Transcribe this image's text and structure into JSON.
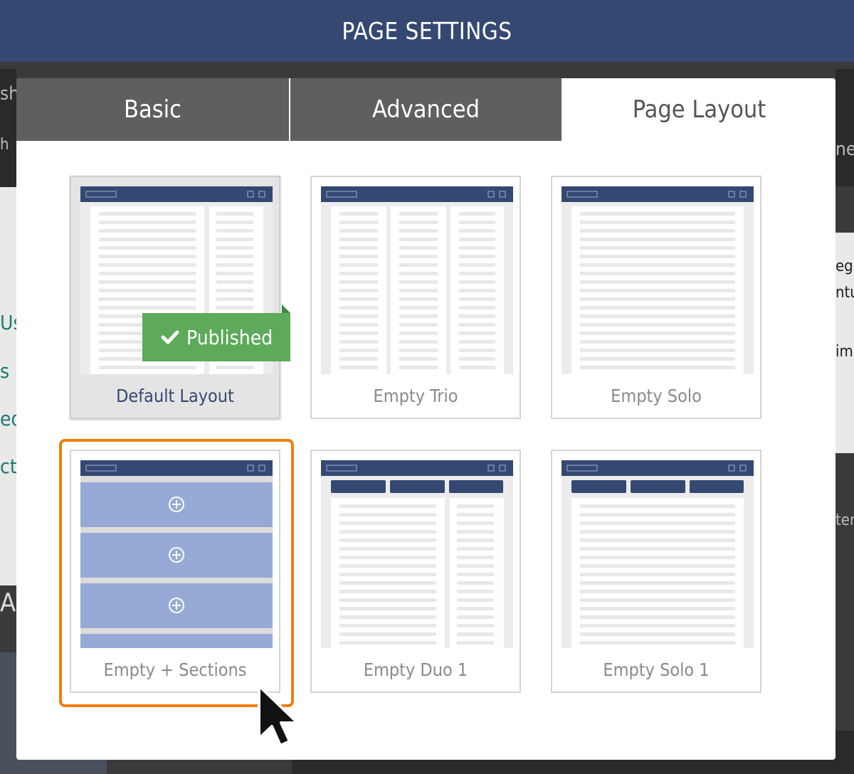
{
  "header": {
    "title": "PAGE SETTINGS"
  },
  "tabs": [
    {
      "label": "Basic",
      "active": false
    },
    {
      "label": "Advanced",
      "active": false
    },
    {
      "label": "Page Layout",
      "active": true
    }
  ],
  "layouts": [
    {
      "label": "Default Layout",
      "published": true
    },
    {
      "label": "Empty Trio"
    },
    {
      "label": "Empty Solo"
    },
    {
      "label": "Empty + Sections",
      "selected": true
    },
    {
      "label": "Empty Duo 1"
    },
    {
      "label": "Empty Solo 1"
    }
  ],
  "badge": {
    "label": "Published"
  },
  "background": {
    "fragments": [
      "sh",
      "h",
      "Us",
      "s",
      "eq",
      "ct",
      "Al",
      "ne",
      "eg",
      "ntu",
      "im.",
      "ter"
    ]
  },
  "colors": {
    "header": "#344872",
    "tab_inactive": "#5f5f5f",
    "published_badge": "#5daa5a",
    "selection_outline": "#f07d0e",
    "section_fill": "#97aad6"
  }
}
